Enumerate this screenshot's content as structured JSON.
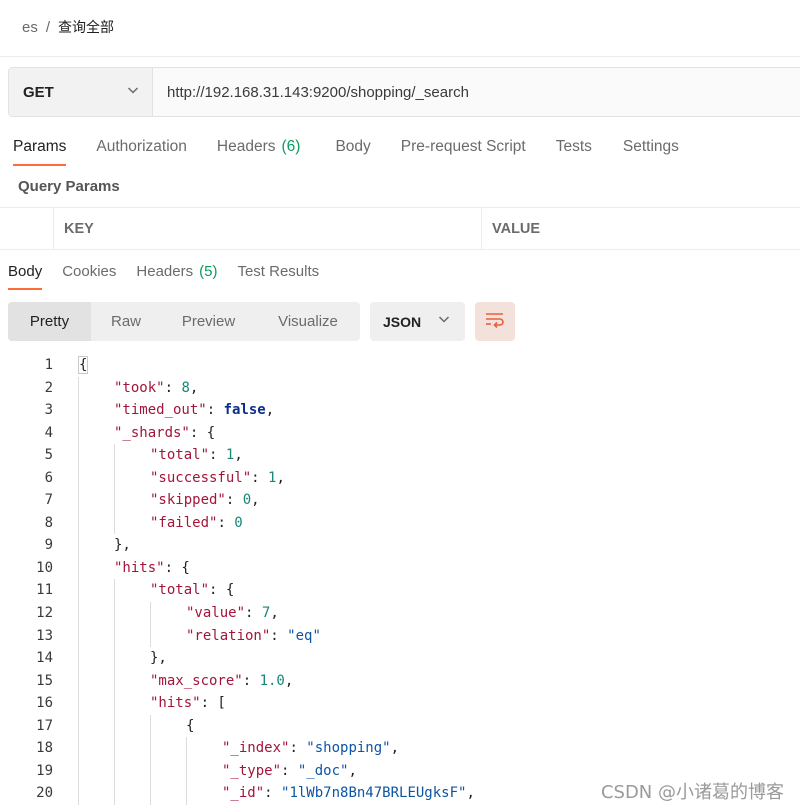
{
  "breadcrumb": {
    "parent": "es",
    "separator": "/",
    "current": "查询全部"
  },
  "request": {
    "method": "GET",
    "url": "http://192.168.31.143:9200/shopping/_search"
  },
  "request_tabs": [
    {
      "label": "Params",
      "count": ""
    },
    {
      "label": "Authorization",
      "count": ""
    },
    {
      "label": "Headers",
      "count": "(6)"
    },
    {
      "label": "Body",
      "count": ""
    },
    {
      "label": "Pre-request Script",
      "count": ""
    },
    {
      "label": "Tests",
      "count": ""
    },
    {
      "label": "Settings",
      "count": ""
    }
  ],
  "query_params": {
    "title": "Query Params",
    "columns": [
      "KEY",
      "VALUE"
    ]
  },
  "response_tabs": [
    {
      "label": "Body",
      "count": ""
    },
    {
      "label": "Cookies",
      "count": ""
    },
    {
      "label": "Headers",
      "count": "(5)"
    },
    {
      "label": "Test Results",
      "count": ""
    }
  ],
  "view_modes": [
    "Pretty",
    "Raw",
    "Preview",
    "Visualize"
  ],
  "active_view": "Pretty",
  "format": "JSON",
  "icons": {
    "method_dropdown": "chevron-down-icon",
    "format_dropdown": "chevron-down-icon",
    "wrap": "wrap-lines-icon"
  },
  "colors": {
    "accent": "#ff6c37",
    "count_green": "#0a9c5d",
    "json_key": "#a3153a",
    "json_string": "#0e55a3",
    "json_number": "#1a8579",
    "json_bool": "#0b2e8c"
  },
  "code_lines": [
    {
      "n": "1",
      "depth": 0,
      "tokens": [
        {
          "t": "p",
          "v": "{"
        }
      ]
    },
    {
      "n": "2",
      "depth": 1,
      "tokens": [
        {
          "t": "k",
          "v": "\"took\""
        },
        {
          "t": "p",
          "v": ": "
        },
        {
          "t": "n",
          "v": "8"
        },
        {
          "t": "p",
          "v": ","
        }
      ]
    },
    {
      "n": "3",
      "depth": 1,
      "tokens": [
        {
          "t": "k",
          "v": "\"timed_out\""
        },
        {
          "t": "p",
          "v": ": "
        },
        {
          "t": "b",
          "v": "false"
        },
        {
          "t": "p",
          "v": ","
        }
      ]
    },
    {
      "n": "4",
      "depth": 1,
      "tokens": [
        {
          "t": "k",
          "v": "\"_shards\""
        },
        {
          "t": "p",
          "v": ": {"
        }
      ]
    },
    {
      "n": "5",
      "depth": 2,
      "tokens": [
        {
          "t": "k",
          "v": "\"total\""
        },
        {
          "t": "p",
          "v": ": "
        },
        {
          "t": "n",
          "v": "1"
        },
        {
          "t": "p",
          "v": ","
        }
      ]
    },
    {
      "n": "6",
      "depth": 2,
      "tokens": [
        {
          "t": "k",
          "v": "\"successful\""
        },
        {
          "t": "p",
          "v": ": "
        },
        {
          "t": "n",
          "v": "1"
        },
        {
          "t": "p",
          "v": ","
        }
      ]
    },
    {
      "n": "7",
      "depth": 2,
      "tokens": [
        {
          "t": "k",
          "v": "\"skipped\""
        },
        {
          "t": "p",
          "v": ": "
        },
        {
          "t": "n",
          "v": "0"
        },
        {
          "t": "p",
          "v": ","
        }
      ]
    },
    {
      "n": "8",
      "depth": 2,
      "tokens": [
        {
          "t": "k",
          "v": "\"failed\""
        },
        {
          "t": "p",
          "v": ": "
        },
        {
          "t": "n",
          "v": "0"
        }
      ]
    },
    {
      "n": "9",
      "depth": 1,
      "tokens": [
        {
          "t": "p",
          "v": "},"
        }
      ]
    },
    {
      "n": "10",
      "depth": 1,
      "tokens": [
        {
          "t": "k",
          "v": "\"hits\""
        },
        {
          "t": "p",
          "v": ": {"
        }
      ]
    },
    {
      "n": "11",
      "depth": 2,
      "tokens": [
        {
          "t": "k",
          "v": "\"total\""
        },
        {
          "t": "p",
          "v": ": {"
        }
      ]
    },
    {
      "n": "12",
      "depth": 3,
      "tokens": [
        {
          "t": "k",
          "v": "\"value\""
        },
        {
          "t": "p",
          "v": ": "
        },
        {
          "t": "n",
          "v": "7"
        },
        {
          "t": "p",
          "v": ","
        }
      ]
    },
    {
      "n": "13",
      "depth": 3,
      "tokens": [
        {
          "t": "k",
          "v": "\"relation\""
        },
        {
          "t": "p",
          "v": ": "
        },
        {
          "t": "s",
          "v": "\"eq\""
        }
      ]
    },
    {
      "n": "14",
      "depth": 2,
      "tokens": [
        {
          "t": "p",
          "v": "},"
        }
      ]
    },
    {
      "n": "15",
      "depth": 2,
      "tokens": [
        {
          "t": "k",
          "v": "\"max_score\""
        },
        {
          "t": "p",
          "v": ": "
        },
        {
          "t": "n",
          "v": "1.0"
        },
        {
          "t": "p",
          "v": ","
        }
      ]
    },
    {
      "n": "16",
      "depth": 2,
      "tokens": [
        {
          "t": "k",
          "v": "\"hits\""
        },
        {
          "t": "p",
          "v": ": ["
        }
      ]
    },
    {
      "n": "17",
      "depth": 3,
      "tokens": [
        {
          "t": "p",
          "v": "{"
        }
      ]
    },
    {
      "n": "18",
      "depth": 4,
      "tokens": [
        {
          "t": "k",
          "v": "\"_index\""
        },
        {
          "t": "p",
          "v": ": "
        },
        {
          "t": "s",
          "v": "\"shopping\""
        },
        {
          "t": "p",
          "v": ","
        }
      ]
    },
    {
      "n": "19",
      "depth": 4,
      "tokens": [
        {
          "t": "k",
          "v": "\"_type\""
        },
        {
          "t": "p",
          "v": ": "
        },
        {
          "t": "s",
          "v": "\"_doc\""
        },
        {
          "t": "p",
          "v": ","
        }
      ]
    },
    {
      "n": "20",
      "depth": 4,
      "tokens": [
        {
          "t": "k",
          "v": "\"_id\""
        },
        {
          "t": "p",
          "v": ": "
        },
        {
          "t": "s",
          "v": "\"1lWb7n8Bn47BRLEUgksF\""
        },
        {
          "t": "p",
          "v": ","
        }
      ]
    }
  ],
  "watermark": "CSDN @小诸葛的博客"
}
